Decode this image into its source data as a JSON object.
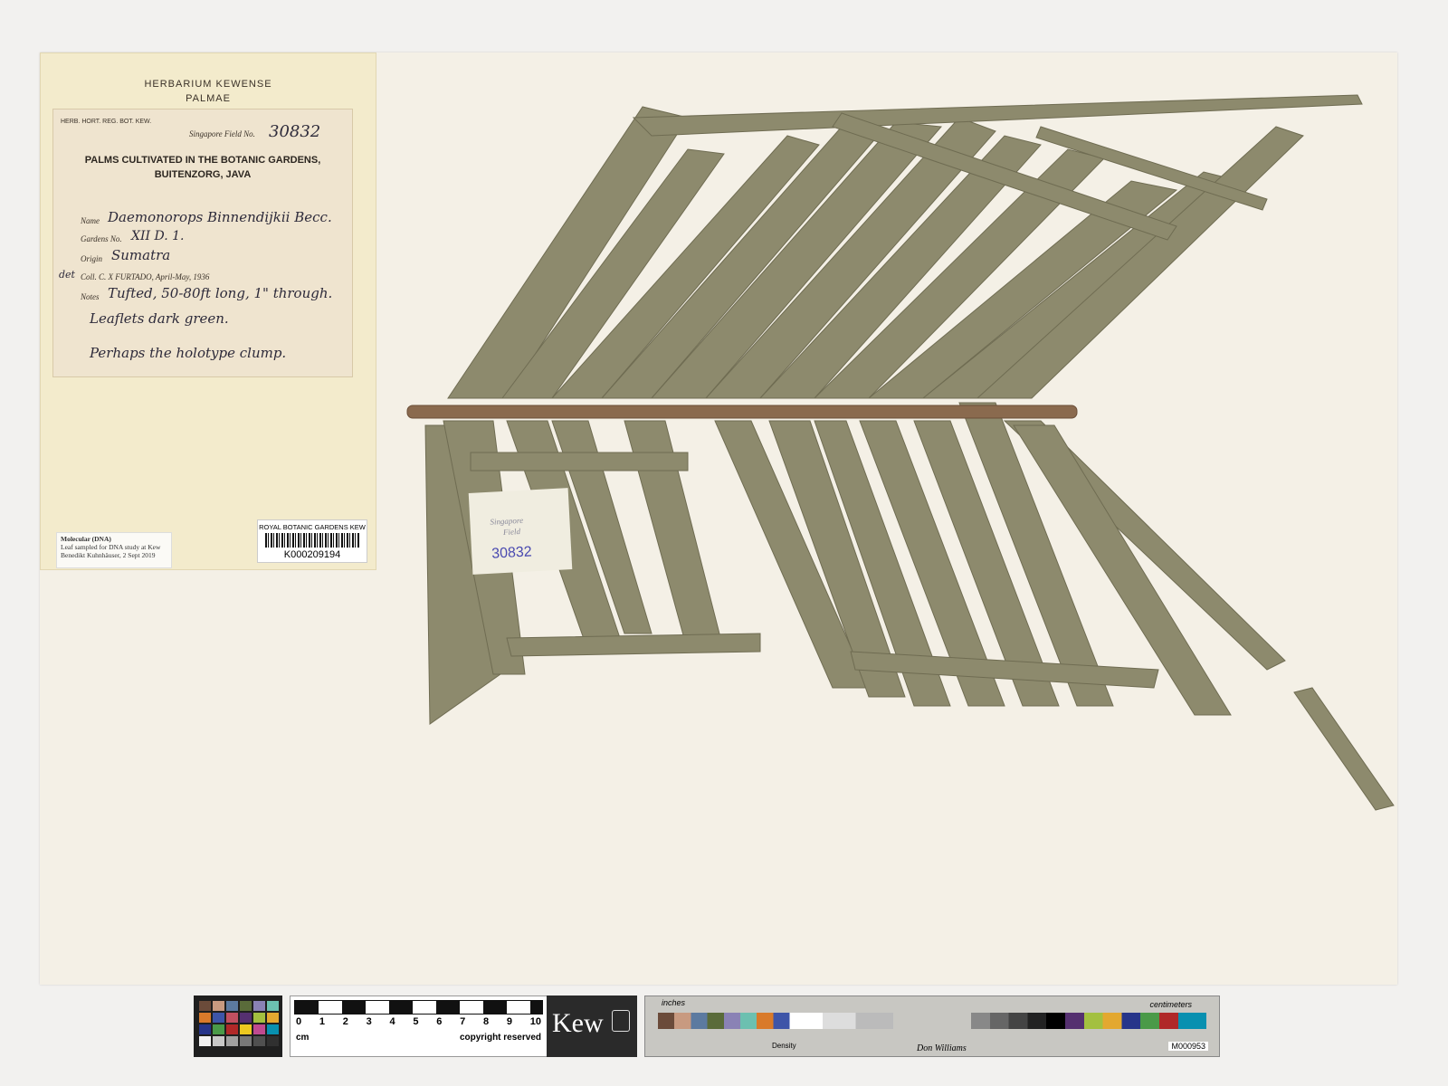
{
  "herbarium_header": {
    "line1": "HERBARIUM KEWENSE",
    "line2": "PALMAE"
  },
  "label": {
    "reg": "HERB. HORT. REG. BOT. KEW.",
    "field_no_label": "Singapore Field No.",
    "field_no": "30832",
    "title1": "PALMS CULTIVATED IN THE BOTANIC GARDENS,",
    "title2": "BUITENZORG, JAVA",
    "name_label": "Name",
    "name": "Daemonorops Binnendijkii Becc.",
    "gardens_label": "Gardens No.",
    "gardens": "XII D. 1.",
    "origin_label": "Origin",
    "origin": "Sumatra",
    "coll": "Coll. C. X FURTADO, April-May, 1936",
    "coll_prefix": "det",
    "notes_label": "Notes",
    "notes1": "Tufted, 50-80ft long, 1\" through.",
    "notes2": "Leaflets dark green.",
    "notes3": "Perhaps the holotype clump."
  },
  "dna_note": {
    "title": "Molecular (DNA)",
    "line1": "Leaf sampled for DNA study at Kew",
    "line2": "Benedikt Kuhnhäuser, 2 Sept 2019"
  },
  "barcode": {
    "institution": "ROYAL BOTANIC GARDENS KEW",
    "id": "K000209194"
  },
  "stamp": {
    "line1": "Singapore",
    "line2": "Field",
    "number": "30832"
  },
  "scale_bar": {
    "ticks": [
      "0",
      "1",
      "2",
      "3",
      "4",
      "5",
      "6",
      "7",
      "8",
      "9",
      "10"
    ],
    "unit": "cm",
    "copyright": "copyright reserved",
    "brand": "Kew"
  },
  "color_target": {
    "inches": "inches",
    "centimeters": "centimeters",
    "density": "Density",
    "maker": "Don Williams",
    "id": "M000953"
  },
  "colors": {
    "leaf": "#8d8a6d",
    "rachis": "#8a6a4e",
    "sheet": "#f4f0e6"
  }
}
